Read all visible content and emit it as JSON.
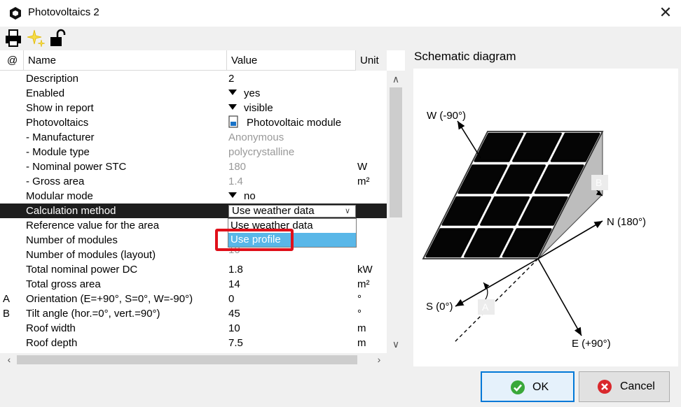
{
  "window": {
    "title": "Photovoltaics 2"
  },
  "grid": {
    "headers": {
      "at": "@",
      "name": "Name",
      "value": "Value",
      "unit": "Unit"
    },
    "rows": [
      {
        "mark": "",
        "name": "Description",
        "value": "2",
        "unit": ""
      },
      {
        "mark": "",
        "name": "Enabled",
        "value": "yes",
        "unit": ""
      },
      {
        "mark": "",
        "name": "Show in report",
        "value": "visible",
        "unit": ""
      },
      {
        "mark": "",
        "name": "Photovoltaics",
        "value": "Photovoltaic module",
        "unit": ""
      },
      {
        "mark": "",
        "name": "- Manufacturer",
        "value": "Anonymous",
        "unit": ""
      },
      {
        "mark": "",
        "name": "- Module type",
        "value": "polycrystalline",
        "unit": ""
      },
      {
        "mark": "",
        "name": "- Nominal power STC",
        "value": "180",
        "unit": "W"
      },
      {
        "mark": "",
        "name": "- Gross area",
        "value": "1.4",
        "unit": "m²"
      },
      {
        "mark": "",
        "name": "Modular mode",
        "value": "no",
        "unit": ""
      },
      {
        "mark": "",
        "name": "Calculation method",
        "value": "Use weather data",
        "unit": ""
      },
      {
        "mark": "",
        "name": "Reference value for the area",
        "value": "",
        "unit": ""
      },
      {
        "mark": "",
        "name": "Number of modules",
        "value": "",
        "unit": ""
      },
      {
        "mark": "",
        "name": "Number of modules (layout)",
        "value": "10",
        "unit": ""
      },
      {
        "mark": "",
        "name": "Total nominal power DC",
        "value": "1.8",
        "unit": "kW"
      },
      {
        "mark": "",
        "name": "Total gross area",
        "value": "14",
        "unit": "m²"
      },
      {
        "mark": "A",
        "name": "Orientation (E=+90°, S=0°, W=-90°)",
        "value": "0",
        "unit": "°"
      },
      {
        "mark": "B",
        "name": "Tilt angle (hor.=0°, vert.=90°)",
        "value": "45",
        "unit": "°"
      },
      {
        "mark": "",
        "name": "Roof width",
        "value": "10",
        "unit": "m"
      },
      {
        "mark": "",
        "name": "Roof depth",
        "value": "7.5",
        "unit": "m"
      }
    ]
  },
  "dropdown": {
    "options": [
      "Use weather data",
      "Use profile"
    ],
    "highlighted": "Use profile"
  },
  "schematic": {
    "title": "Schematic diagram",
    "labels": {
      "west": "W (-90°)",
      "north": "N (180°)",
      "south": "S (0°)",
      "east": "E (+90°)",
      "a": "A",
      "b": "B"
    }
  },
  "buttons": {
    "ok": "OK",
    "cancel": "Cancel"
  },
  "colors": {
    "selection": "#1e1e1e",
    "highlight": "#59b7e8",
    "callout": "#e0101a",
    "ok_border": "#0078d7"
  },
  "icons": [
    "app-icon",
    "printer-icon",
    "sparkle-icon",
    "unlock-icon",
    "checkmark-icon",
    "cancel-x-icon",
    "close-icon"
  ]
}
